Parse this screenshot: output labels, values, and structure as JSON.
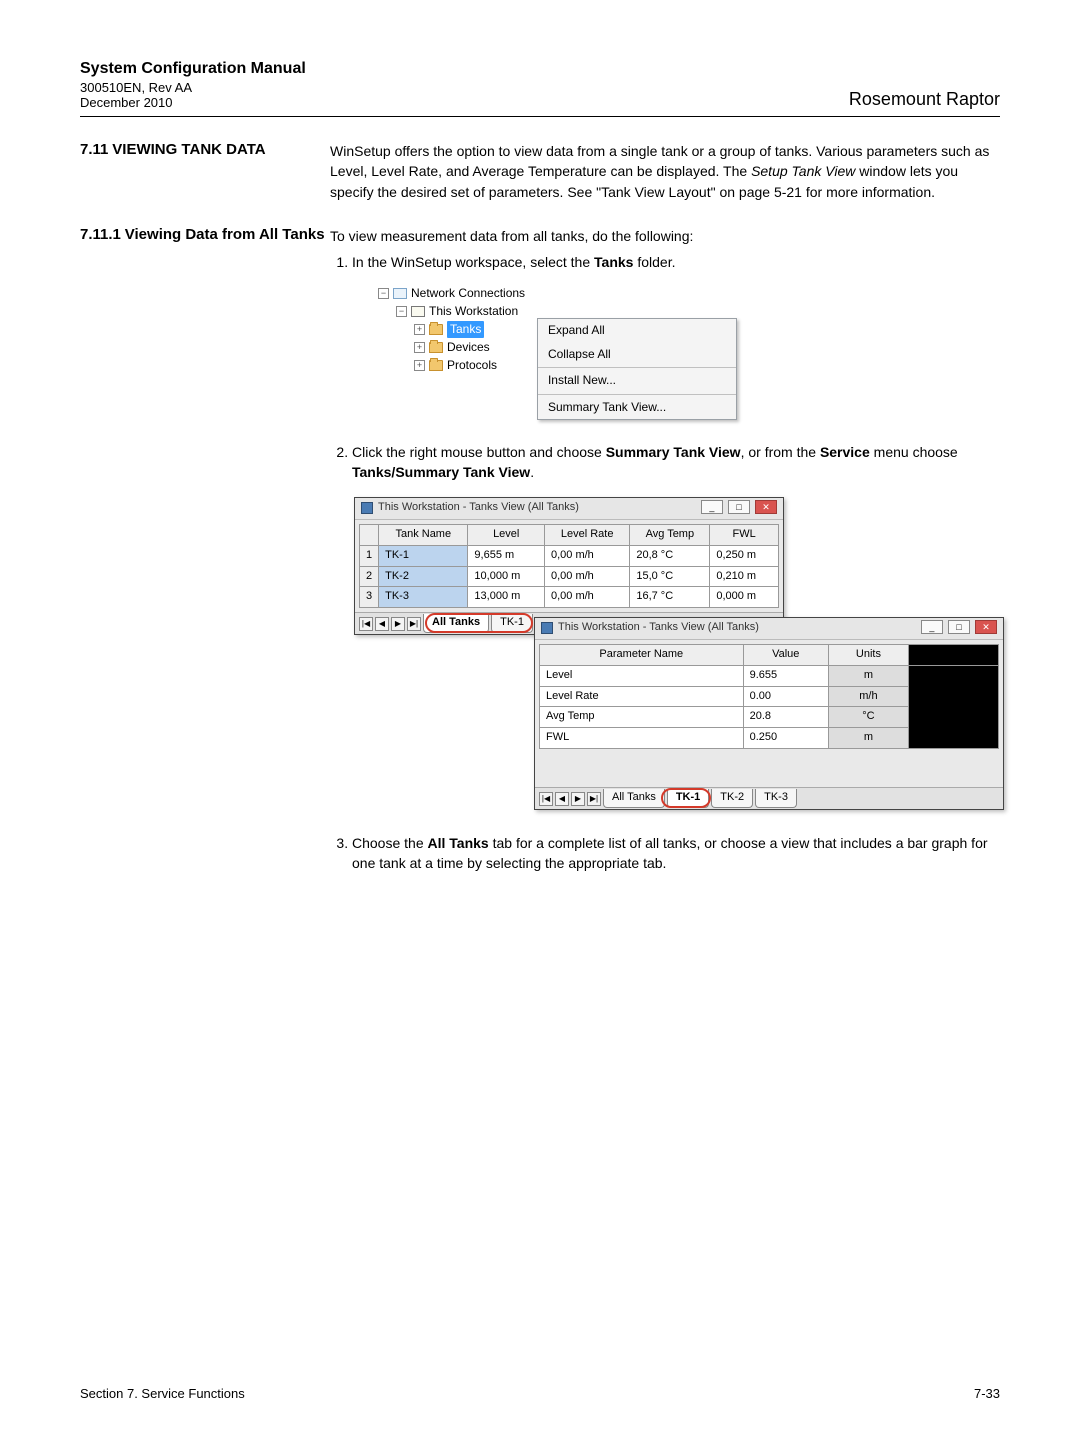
{
  "doc": {
    "title": "System Configuration Manual",
    "rev": "300510EN, Rev AA",
    "date": "December 2010",
    "brand": "Rosemount Raptor"
  },
  "sec_main": {
    "num": "7.11",
    "title": "VIEWING TANK DATA",
    "para": "WinSetup offers the option to view data from a single tank or a group of tanks. Various parameters such as Level, Level Rate, and Average Temperature can be displayed. The ",
    "para_em": "Setup Tank View",
    "para2": " window lets you specify the desired set of parameters. See \"Tank View Layout\" on page 5-21 for more information."
  },
  "sec_sub": {
    "num": "7.11.1",
    "title": "Viewing Data from All Tanks",
    "intro": "To view measurement data from all tanks, do the following:",
    "step1_a": "In the WinSetup workspace, select the ",
    "step1_b": "Tanks",
    "step1_c": " folder.",
    "step2_a": "Click the right mouse button and choose ",
    "step2_b": "Summary Tank View",
    "step2_c": ", or from the ",
    "step2_d": "Service",
    "step2_e": " menu choose ",
    "step2_f": "Tanks/Summary Tank View",
    "step2_g": ".",
    "step3_a": "Choose the ",
    "step3_b": "All Tanks",
    "step3_c": " tab for a complete list of all tanks, or choose a view that includes a bar graph for one tank at a time by selecting the appropriate tab."
  },
  "tree": {
    "root": "Network Connections",
    "ws": "This Workstation",
    "tanks": "Tanks",
    "devices": "Devices",
    "protocols": "Protocols"
  },
  "ctx": {
    "expand": "Expand All",
    "collapse": "Collapse All",
    "install": "Install New...",
    "summary": "Summary Tank View..."
  },
  "winA": {
    "title": "This Workstation - Tanks View  (All Tanks)",
    "headers": [
      "",
      "Tank Name",
      "Level",
      "Level Rate",
      "Avg Temp",
      "FWL"
    ],
    "rows": [
      [
        "1",
        "TK-1",
        "9,655 m",
        "0,00 m/h",
        "20,8 °C",
        "0,250 m"
      ],
      [
        "2",
        "TK-2",
        "10,000 m",
        "0,00 m/h",
        "15,0 °C",
        "0,210 m"
      ],
      [
        "3",
        "TK-3",
        "13,000 m",
        "0,00 m/h",
        "16,7 °C",
        "0,000 m"
      ]
    ],
    "tabs": [
      "All Tanks",
      "TK-1"
    ]
  },
  "winB": {
    "title": "This Workstation - Tanks View  (All Tanks)",
    "headers": [
      "Parameter Name",
      "Value",
      "Units",
      ""
    ],
    "rows": [
      [
        "Level",
        "9.655",
        "m"
      ],
      [
        "Level Rate",
        "0.00",
        "m/h"
      ],
      [
        "Avg Temp",
        "20.8",
        "°C"
      ],
      [
        "FWL",
        "0.250",
        "m"
      ]
    ],
    "tabs": [
      "All Tanks",
      "TK-1",
      "TK-2",
      "TK-3"
    ]
  },
  "footer": {
    "left": "Section 7. Service Functions",
    "right": "7-33"
  }
}
